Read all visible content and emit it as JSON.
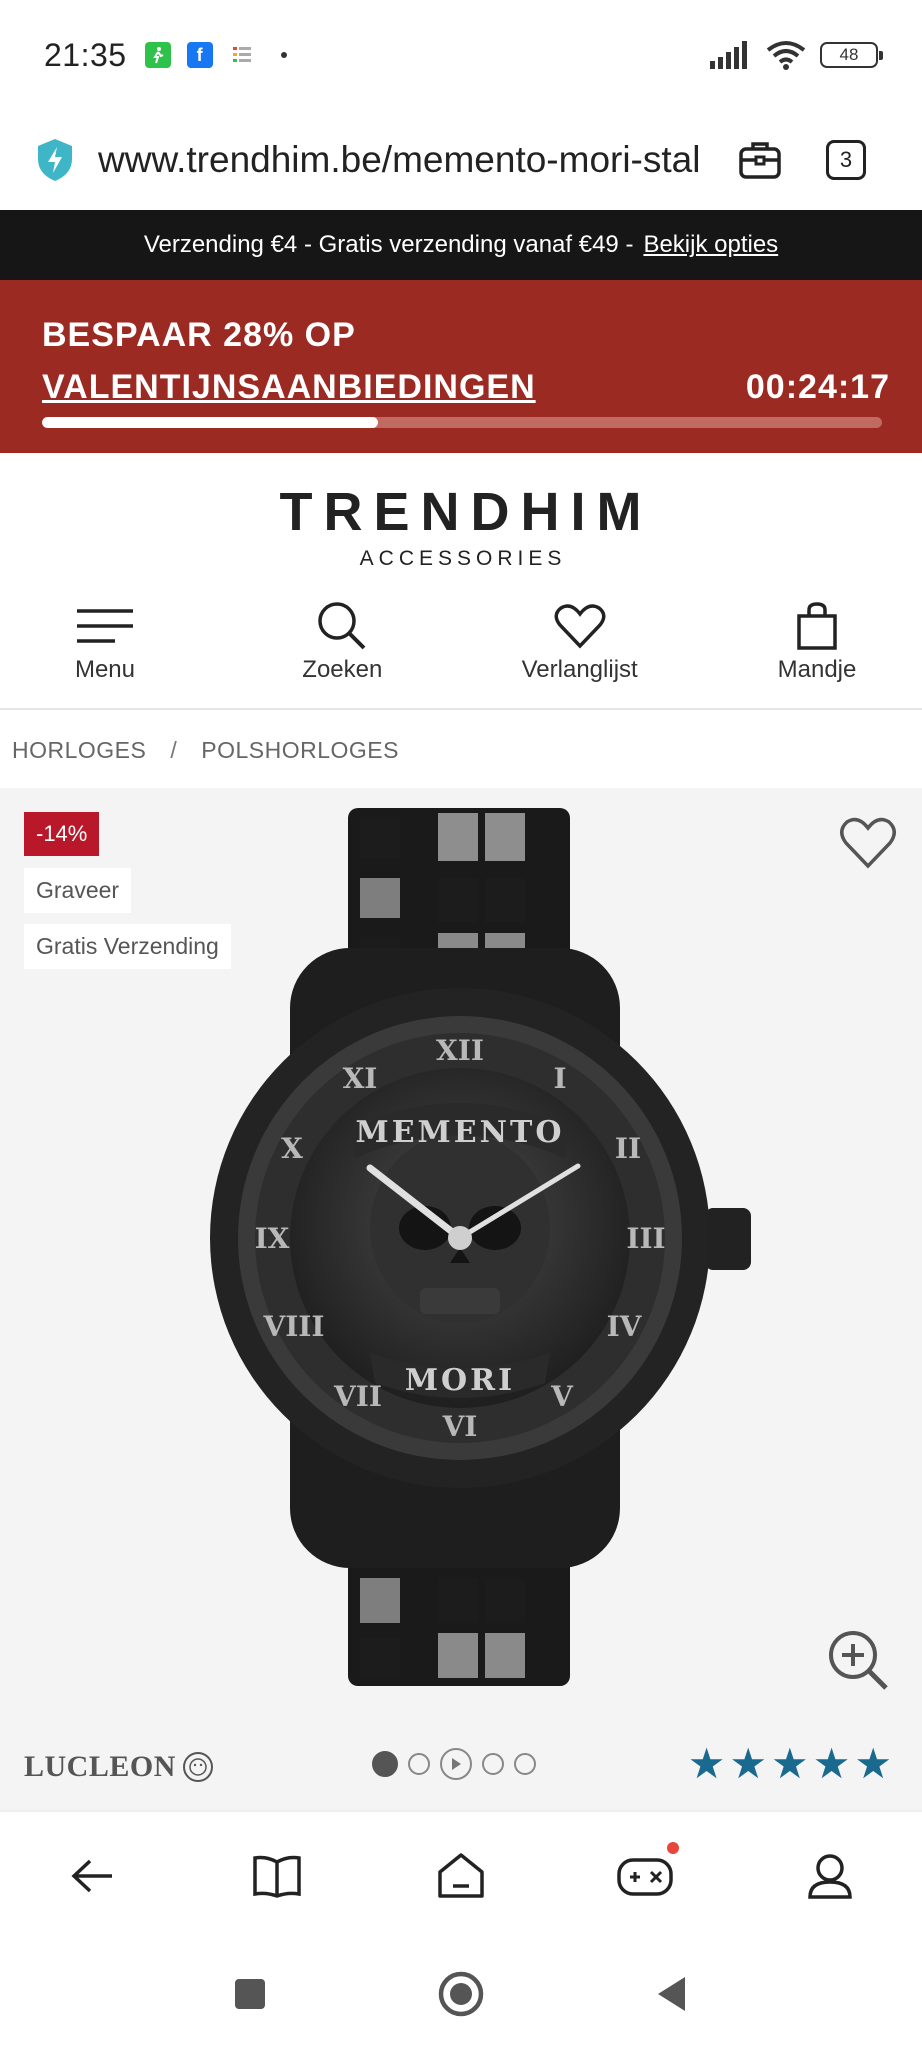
{
  "status_bar": {
    "time": "21:35",
    "notification_icons": [
      "pedometer-icon",
      "facebook-icon",
      "list-app-icon"
    ],
    "battery_level": "48"
  },
  "browser": {
    "url": "www.trendhim.be/memento-mori-stal",
    "tab_count": "3"
  },
  "shipping_banner": {
    "text": "Verzending €4 - Gratis verzending vanaf €49 - ",
    "link": "Bekijk opties"
  },
  "sale_banner": {
    "line1": "BESPAAR 28% OP",
    "line2": "VALENTIJNSAANBIEDINGEN",
    "timer": "00:24:17",
    "progress": 0.4,
    "color": "#9b2a22"
  },
  "logo": {
    "main": "TRENDHIM",
    "sub": "ACCESSORIES"
  },
  "nav": [
    {
      "label": "Menu",
      "icon": "hamburger-icon"
    },
    {
      "label": "Zoeken",
      "icon": "search-icon"
    },
    {
      "label": "Verlanglijst",
      "icon": "heart-icon"
    },
    {
      "label": "Mandje",
      "icon": "bag-icon"
    }
  ],
  "breadcrumb": {
    "items": [
      "HORLOGES",
      "POLSHORLOGES"
    ],
    "separator": "/"
  },
  "product": {
    "badges": {
      "discount": "-14%",
      "engrave": "Graveer",
      "shipping": "Gratis Verzending"
    },
    "watch_text": {
      "top": "MEMENTO",
      "bottom": "MORI"
    },
    "brand": "LUCLEON",
    "gallery_dots": 5,
    "gallery_active": 1,
    "rating": 5,
    "star_color": "#1a6a8f"
  },
  "browser_nav": [
    "back-icon",
    "bookmarks-icon",
    "home-icon",
    "games-icon",
    "profile-icon"
  ],
  "system_nav": [
    "recents-icon",
    "home-circle-icon",
    "back-triangle-icon"
  ]
}
